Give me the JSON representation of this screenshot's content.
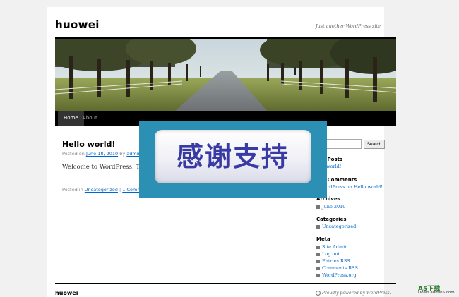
{
  "site": {
    "title": "huowei",
    "description": "Just another WordPress site"
  },
  "nav": {
    "items": [
      {
        "label": "Home"
      },
      {
        "label": "About"
      }
    ]
  },
  "post": {
    "title": "Hello world!",
    "meta_prefix": "Posted on",
    "date": "June 18, 2010",
    "meta_by": "by",
    "author": "admin",
    "body": "Welcome to WordPress. This i",
    "util_prefix": "Posted in",
    "category": "Uncategorized",
    "util_sep": "|",
    "comments": "1 Comment"
  },
  "overlay": {
    "text": "感谢支持",
    "bg_color": "#2c8fb4",
    "text_color": "#3a3aa5"
  },
  "sidebar": {
    "search_button": "Search",
    "recent_posts": {
      "title": "ent Posts",
      "items": [
        "ello world!"
      ]
    },
    "recent_comments": {
      "title": "ent Comments",
      "text": "r WordPress on Hello world!"
    },
    "archives": {
      "title": "Archives",
      "items": [
        "June 2010"
      ]
    },
    "categories": {
      "title": "Categories",
      "items": [
        "Uncategorized"
      ]
    },
    "meta": {
      "title": "Meta",
      "items": [
        "Site Admin",
        "Log out",
        "Entries RSS",
        "Comments RSS",
        "WordPress.org"
      ]
    }
  },
  "footer": {
    "title": "huowei",
    "credit": "Proudly powered by WordPress."
  },
  "watermark": {
    "top": "A5下载",
    "sub": "Down.admin5.com"
  },
  "colors": {
    "link": "#0066cc",
    "nav_bg": "#000000"
  }
}
